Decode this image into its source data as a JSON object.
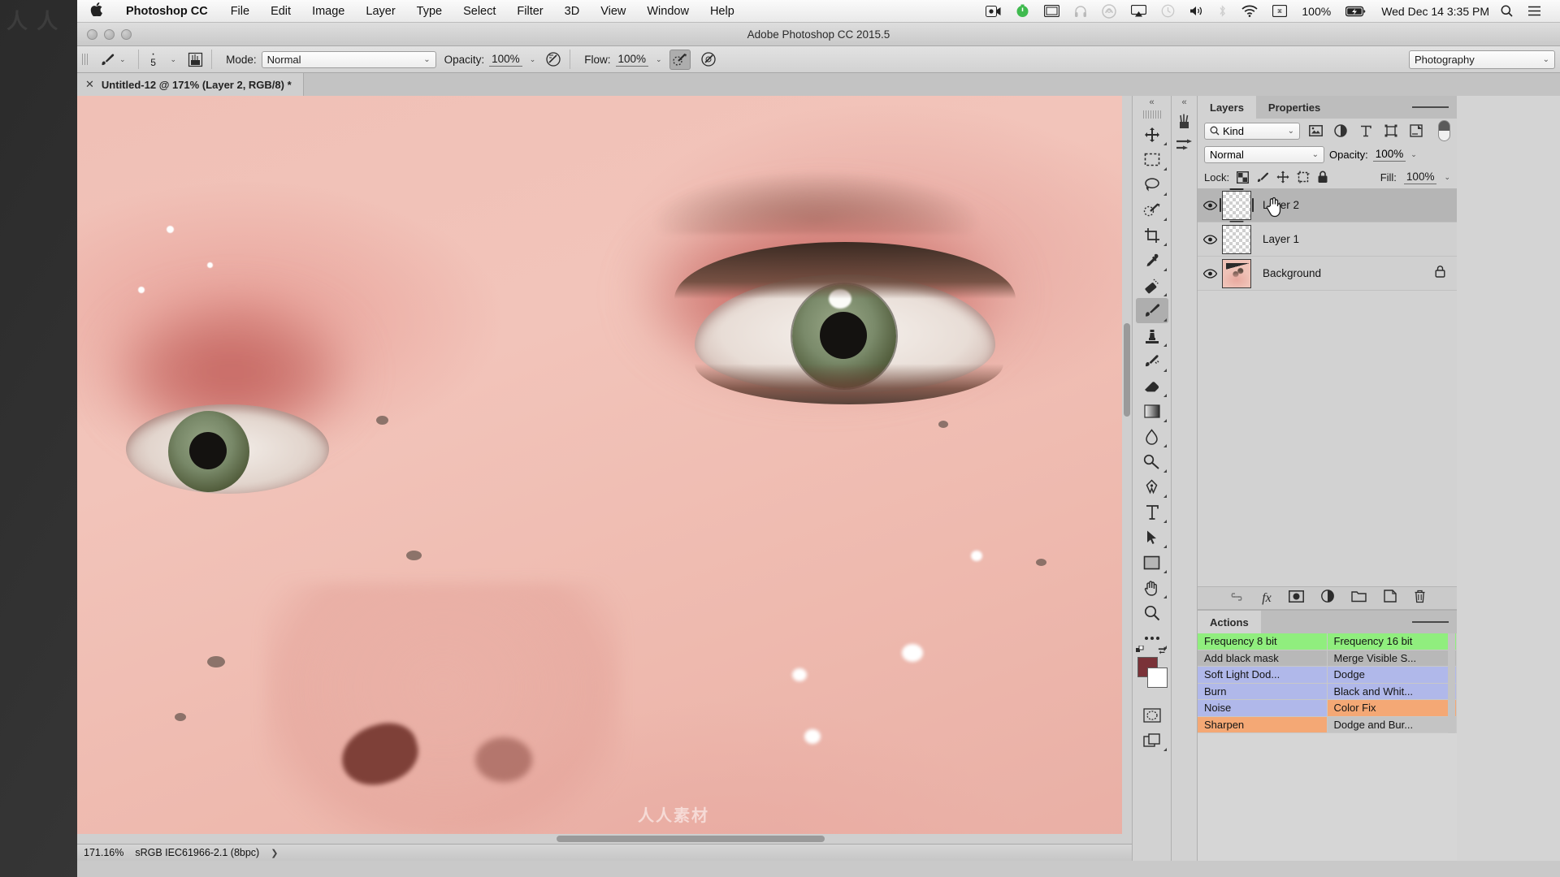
{
  "menubar": {
    "apple_icon": "apple-icon",
    "app_name": "Photoshop CC",
    "menus": [
      "File",
      "Edit",
      "Image",
      "Layer",
      "Type",
      "Select",
      "Filter",
      "3D",
      "View",
      "Window",
      "Help"
    ],
    "status_icons": [
      "screen-record-icon",
      "time-tracker-icon",
      "display-icon",
      "headphones-icon",
      "creative-cloud-icon",
      "airplay-icon",
      "timemachine-icon",
      "volume-icon",
      "bluetooth-icon",
      "wifi-icon",
      "input-source-icon"
    ],
    "battery_percent": "100%",
    "battery_icon": "battery-charging-icon",
    "clock": "Wed Dec 14  3:35 PM",
    "search_icon": "search-icon",
    "control_center_icon": "notification-center-icon"
  },
  "window": {
    "title": "Adobe Photoshop CC 2015.5",
    "traffic_lights": [
      "close-button",
      "minimize-button",
      "zoom-button"
    ]
  },
  "options_bar": {
    "tool_icon": "brush-tool-icon",
    "brush_size": "5",
    "brush_preset_icon": "brush-panel-icon",
    "mode_label": "Mode:",
    "mode_value": "Normal",
    "opacity_label": "Opacity:",
    "opacity_value": "100%",
    "pressure_opacity_icon": "tablet-pressure-opacity-icon",
    "flow_label": "Flow:",
    "flow_value": "100%",
    "airbrush_icon": "airbrush-icon",
    "smoothing_icon": "smoothing-icon",
    "workspace_value": "Photography"
  },
  "document": {
    "tab_label": "Untitled-12 @ 171% (Layer 2, RGB/8) *",
    "close_icon": "close-tab-icon"
  },
  "status_bar": {
    "zoom": "171.16%",
    "color_profile": "sRGB IEC61966-2.1 (8bpc)",
    "expand_icon": "chevron-right-icon"
  },
  "toolbar": {
    "collapse_icon": "collapse-panel-icon",
    "tools": [
      {
        "name": "move-tool",
        "icon": "move-icon",
        "active": false
      },
      {
        "name": "marquee-tool",
        "icon": "rectangular-marquee-icon",
        "active": false
      },
      {
        "name": "lasso-tool",
        "icon": "lasso-icon",
        "active": false
      },
      {
        "name": "quick-selection-tool",
        "icon": "quick-selection-icon",
        "active": false
      },
      {
        "name": "crop-tool",
        "icon": "crop-icon",
        "active": false
      },
      {
        "name": "eyedropper-tool",
        "icon": "eyedropper-icon",
        "active": false
      },
      {
        "name": "healing-brush-tool",
        "icon": "spot-healing-icon",
        "active": false
      },
      {
        "name": "brush-tool",
        "icon": "brush-icon",
        "active": true
      },
      {
        "name": "clone-stamp-tool",
        "icon": "clone-stamp-icon",
        "active": false
      },
      {
        "name": "history-brush-tool",
        "icon": "history-brush-icon",
        "active": false
      },
      {
        "name": "eraser-tool",
        "icon": "eraser-icon",
        "active": false
      },
      {
        "name": "gradient-tool",
        "icon": "gradient-icon",
        "active": false
      },
      {
        "name": "blur-tool",
        "icon": "blur-droplet-icon",
        "active": false
      },
      {
        "name": "dodge-tool",
        "icon": "dodge-icon",
        "active": false
      },
      {
        "name": "pen-tool",
        "icon": "pen-icon",
        "active": false
      },
      {
        "name": "type-tool",
        "icon": "type-t-icon",
        "active": false
      },
      {
        "name": "path-selection-tool",
        "icon": "path-arrow-icon",
        "active": false
      },
      {
        "name": "rectangle-tool",
        "icon": "rectangle-shape-icon",
        "active": false
      },
      {
        "name": "hand-tool",
        "icon": "hand-icon",
        "active": false
      },
      {
        "name": "zoom-tool",
        "icon": "magnifier-icon",
        "active": false
      },
      {
        "name": "edit-toolbar",
        "icon": "ellipsis-icon",
        "active": false
      }
    ],
    "foreground_color": "#7a3238",
    "background_color": "#ffffff",
    "quick_mask_icon": "quick-mask-icon",
    "screen_mode_icon": "screen-mode-icon"
  },
  "side_panel_icons": [
    "brushes-panel-icon",
    "brush-settings-panel-icon"
  ],
  "layers_panel": {
    "tabs": [
      {
        "label": "Layers",
        "active": true
      },
      {
        "label": "Properties",
        "active": false
      }
    ],
    "menu_icon": "panel-menu-icon",
    "filter": {
      "search_icon": "search-icon",
      "kind_label": "Kind",
      "type_icons": [
        "filter-pixel-icon",
        "filter-adjustment-icon",
        "filter-type-icon",
        "filter-shape-icon",
        "filter-smart-object-icon"
      ],
      "toggle_icon": "filter-enable-toggle"
    },
    "blend_mode": "Normal",
    "opacity_label": "Opacity:",
    "opacity_value": "100%",
    "lock_label": "Lock:",
    "lock_icons": [
      "lock-transparency-icon",
      "lock-image-icon",
      "lock-position-icon",
      "lock-artboard-icon",
      "lock-all-icon"
    ],
    "fill_label": "Fill:",
    "fill_value": "100%",
    "layers": [
      {
        "name": "Layer 2",
        "selected": true,
        "visible": true,
        "thumb": "transparent",
        "locked": false
      },
      {
        "name": "Layer 1",
        "selected": false,
        "visible": true,
        "thumb": "transparent",
        "locked": false
      },
      {
        "name": "Background",
        "selected": false,
        "visible": true,
        "thumb": "photo",
        "locked": true
      }
    ],
    "footer_icons": [
      "link-layers-icon",
      "layer-styles-fx-icon",
      "add-mask-icon",
      "adjustment-layer-icon",
      "new-group-icon",
      "new-layer-icon",
      "delete-layer-icon"
    ]
  },
  "actions_panel": {
    "tabs": [
      {
        "label": "Actions",
        "active": true
      }
    ],
    "menu_icon": "panel-menu-icon",
    "rows": [
      [
        {
          "label": "Frequency 8 bit",
          "color": "#90ee7e"
        },
        {
          "label": "Frequency 16 bit",
          "color": "#90ee7e"
        }
      ],
      [
        {
          "label": "Add black mask",
          "color": "#b8b8b8"
        },
        {
          "label": "Merge Visible S...",
          "color": "#b8b8b8"
        }
      ],
      [
        {
          "label": "Soft Light Dod...",
          "color": "#b0b8ea"
        },
        {
          "label": "Dodge",
          "color": "#b0b8ea"
        }
      ],
      [
        {
          "label": "Burn",
          "color": "#b0b8ea"
        },
        {
          "label": "Black and Whit...",
          "color": "#b0b8ea"
        }
      ],
      [
        {
          "label": "Noise",
          "color": "#b0b8ea"
        },
        {
          "label": "Color Fix",
          "color": "#f4a875"
        }
      ],
      [
        {
          "label": "Sharpen",
          "color": "#f4a875"
        },
        {
          "label": "Dodge and Bur...",
          "color": "#c4c4c4"
        }
      ]
    ]
  },
  "watermark": {
    "desktop_left": "人 人",
    "canvas": "人人素材"
  }
}
